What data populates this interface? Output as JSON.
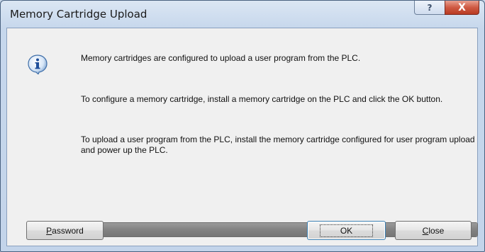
{
  "window": {
    "title": "Memory Cartridge Upload",
    "help_label": "?",
    "close_label": "X"
  },
  "messages": {
    "line1": "Memory cartridges are configured to upload a user program from the PLC.",
    "line2": "To configure a memory cartridge, install a memory cartridge on the PLC and click the OK button.",
    "line3": "To upload a user program from the PLC, install the memory cartridge configured for user program upload and power up the PLC."
  },
  "progress": {
    "fraction": 1.0
  },
  "buttons": {
    "password_access": "P",
    "password_rest": "assword",
    "ok": "OK",
    "close_access": "C",
    "close_rest": "lose"
  },
  "icons": {
    "info": "info-icon"
  }
}
